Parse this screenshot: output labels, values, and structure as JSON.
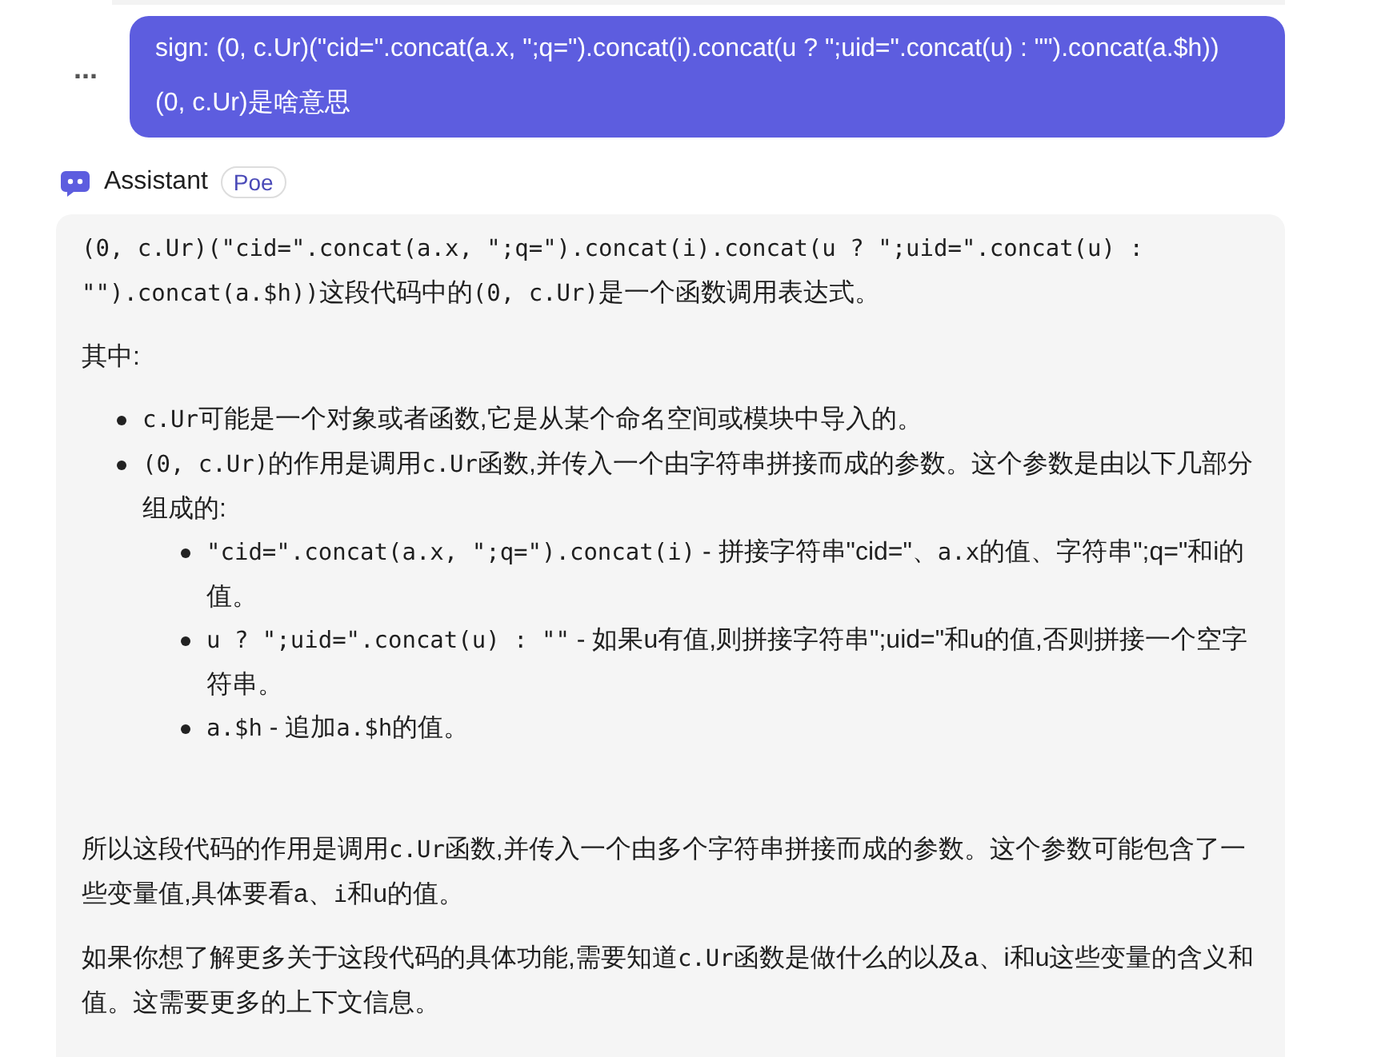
{
  "user_message": {
    "more_button": "...",
    "paragraphs": [
      "sign: (0, c.Ur)(\"cid=\".concat(a.x, \";q=\").concat(i).concat(u ? \";uid=\".concat(u) : \"\").concat(a.$h))",
      "(0, c.Ur)是啥意思"
    ]
  },
  "assistant": {
    "name": "Assistant",
    "badge": "Poe"
  },
  "reply": [
    {
      "kind": "paragraph",
      "segments": [
        {
          "kind": "code",
          "text": "(0, c.Ur)(\"cid=\".concat(a.x, \";q=\").concat(i).concat(u ? \";uid=\".concat(u) : \"\").concat(a.$h))"
        },
        {
          "kind": "text",
          "text": "这段代码中的"
        },
        {
          "kind": "code",
          "text": "(0, c.Ur)"
        },
        {
          "kind": "text",
          "text": "是一个函数调用表达式。"
        }
      ]
    },
    {
      "kind": "paragraph",
      "segments": [
        {
          "kind": "text",
          "text": "其中:"
        }
      ]
    },
    {
      "kind": "list",
      "items": [
        {
          "segments": [
            {
              "kind": "code",
              "text": "c.Ur"
            },
            {
              "kind": "text",
              "text": "可能是一个对象或者函数,它是从某个命名空间或模块中导入的。"
            }
          ]
        },
        {
          "segments": [
            {
              "kind": "code",
              "text": "(0, c.Ur)"
            },
            {
              "kind": "text",
              "text": "的作用是调用"
            },
            {
              "kind": "code",
              "text": "c.Ur"
            },
            {
              "kind": "text",
              "text": "函数,并传入一个由字符串拼接而成的参数。这个参数是由以下几部分组成的:"
            }
          ],
          "children": [
            {
              "segments": [
                {
                  "kind": "code",
                  "text": "\"cid=\".concat(a.x, \";q=\").concat(i)"
                },
                {
                  "kind": "text",
                  "text": " - 拼接字符串\"cid=\"、"
                },
                {
                  "kind": "code",
                  "text": "a.x"
                },
                {
                  "kind": "text",
                  "text": "的值、字符串\";q=\"和i的值。"
                }
              ]
            },
            {
              "segments": [
                {
                  "kind": "code",
                  "text": "u ? \";uid=\".concat(u) : \"\""
                },
                {
                  "kind": "text",
                  "text": " - 如果u有值,则拼接字符串\";uid=\"和u的值,否则拼接一个空字符串。"
                }
              ]
            },
            {
              "segments": [
                {
                  "kind": "code",
                  "text": "a.$h"
                },
                {
                  "kind": "text",
                  "text": " - 追加"
                },
                {
                  "kind": "code",
                  "text": "a.$h"
                },
                {
                  "kind": "text",
                  "text": "的值。"
                }
              ]
            }
          ]
        }
      ]
    },
    {
      "kind": "paragraph",
      "segments": [
        {
          "kind": "text",
          "text": "所以这段代码的作用是调用"
        },
        {
          "kind": "code",
          "text": "c.Ur"
        },
        {
          "kind": "text",
          "text": "函数,并传入一个由多个字符串拼接而成的参数。这个参数可能包含了一些变量值,具体要看a、"
        },
        {
          "kind": "code",
          "text": "i"
        },
        {
          "kind": "text",
          "text": "和u的值。"
        }
      ]
    },
    {
      "kind": "paragraph",
      "segments": [
        {
          "kind": "text",
          "text": "如果你想了解更多关于这段代码的具体功能,需要知道"
        },
        {
          "kind": "code",
          "text": "c.Ur"
        },
        {
          "kind": "text",
          "text": "函数是做什么的以及a、i和u这些变量的含义和值。这需要更多的上下文信息。"
        }
      ]
    }
  ]
}
